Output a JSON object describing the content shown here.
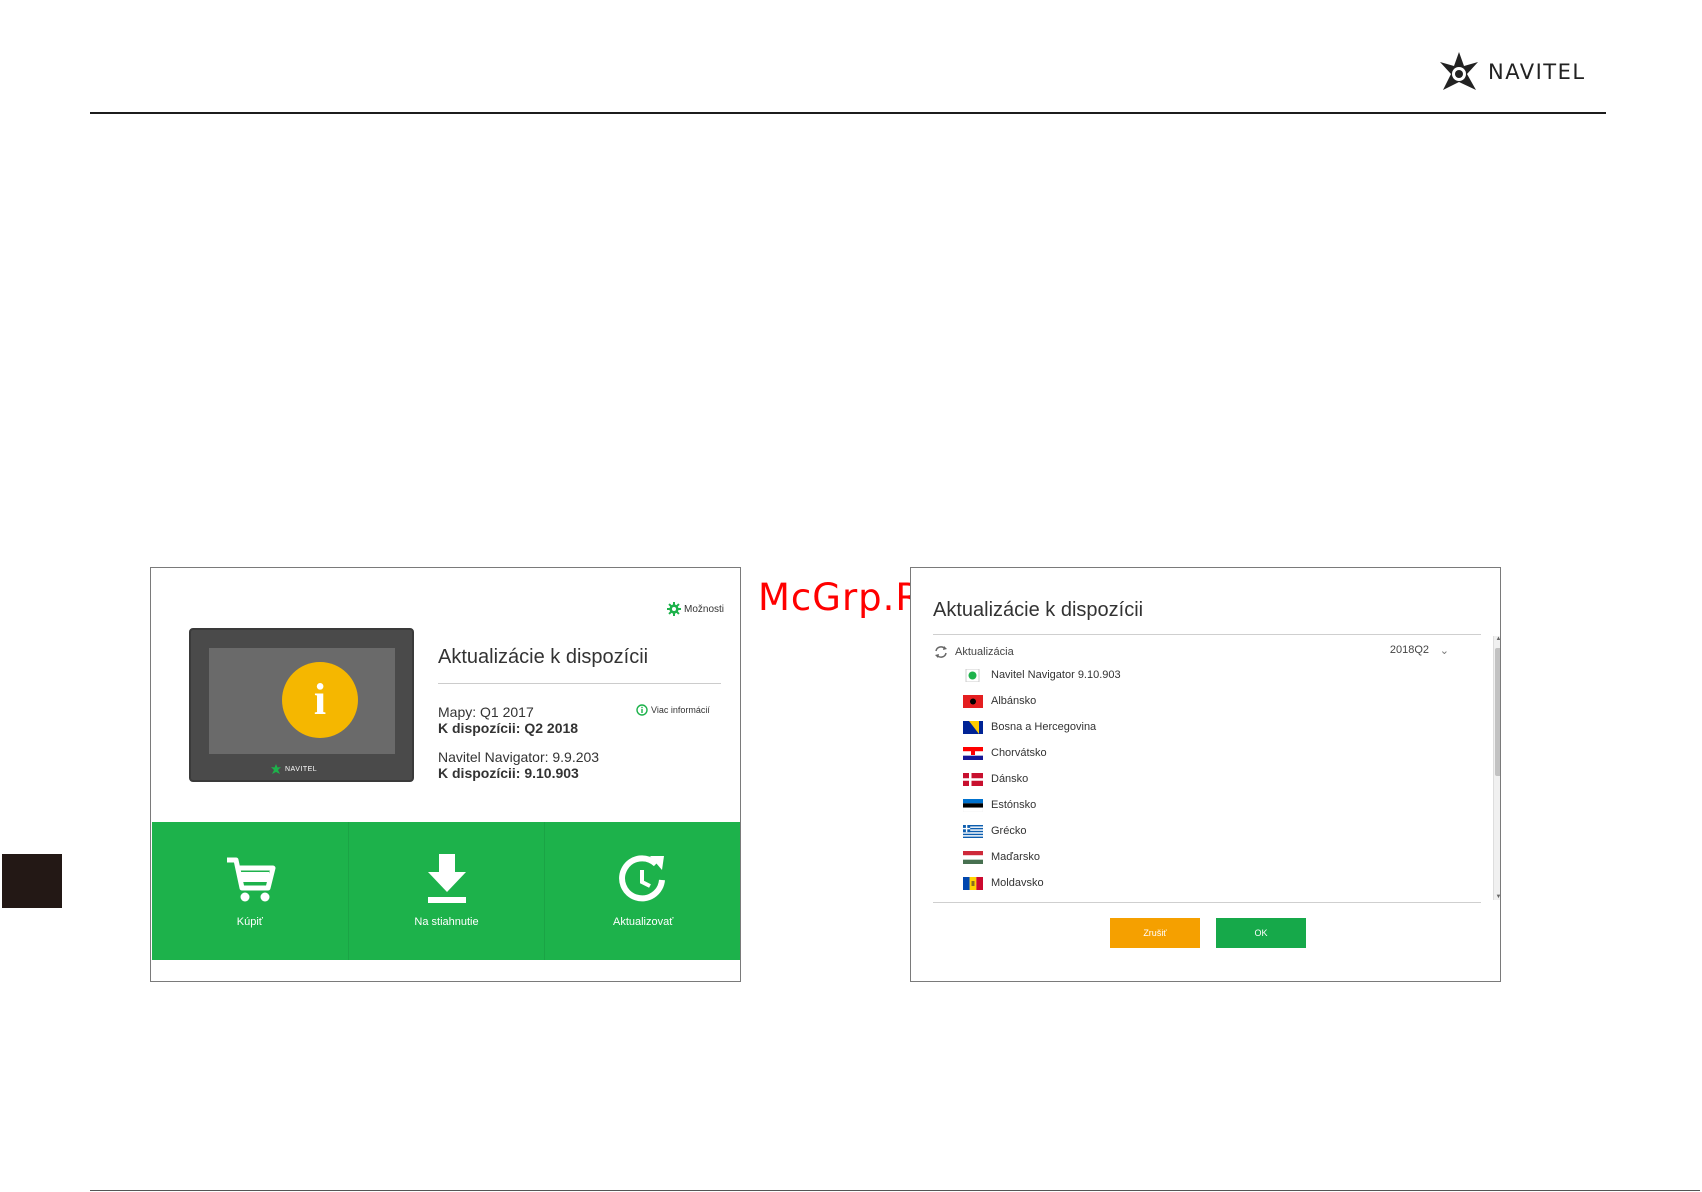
{
  "header": {
    "brand": "NAVITEL"
  },
  "watermark": "McGrp.Ru",
  "left_panel": {
    "options_label": "Možnosti",
    "device_logo": "NAVITEL",
    "title": "Aktualizácie k dispozícii",
    "more_info": "Viac informácií",
    "maps_current": "Mapy: Q1 2017",
    "maps_available": "K dispozícii: Q2 2018",
    "nav_current": "Navitel Navigator: 9.9.203",
    "nav_available": "K dispozícii: 9.10.903",
    "actions": [
      {
        "label": "Kúpiť",
        "icon": "cart-icon"
      },
      {
        "label": "Na stiahnutie",
        "icon": "download-icon"
      },
      {
        "label": "Aktualizovať",
        "icon": "refresh-icon"
      }
    ]
  },
  "right_panel": {
    "title": "Aktualizácie k dispozícii",
    "group_label": "Aktualizácia",
    "group_version": "2018Q2",
    "items": [
      {
        "label": "Navitel Navigator 9.10.903",
        "icon": "navitel-app-icon"
      },
      {
        "label": "Albánsko",
        "icon": "albania-flag"
      },
      {
        "label": "Bosna a Hercegovina",
        "icon": "bosnia-flag"
      },
      {
        "label": "Chorvátsko",
        "icon": "croatia-flag"
      },
      {
        "label": "Dánsko",
        "icon": "denmark-flag"
      },
      {
        "label": "Estónsko",
        "icon": "estonia-flag"
      },
      {
        "label": "Grécko",
        "icon": "greece-flag"
      },
      {
        "label": "Maďarsko",
        "icon": "hungary-flag"
      },
      {
        "label": "Moldavsko",
        "icon": "moldova-flag"
      }
    ],
    "cancel_label": "Zrušiť",
    "ok_label": "OK"
  },
  "colors": {
    "green": "#1db24b",
    "orange": "#f5a000",
    "info_yellow": "#f5b700"
  }
}
